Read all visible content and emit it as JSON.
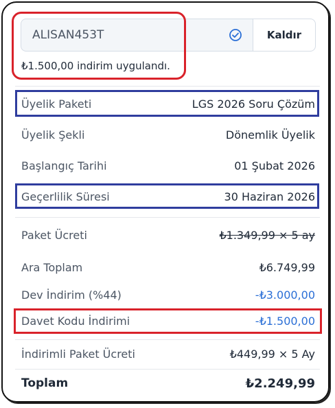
{
  "coupon": {
    "code": "ALISAN453T",
    "remove_label": "Kaldır",
    "applied_message": "₺1.500,00 indirim uygulandı."
  },
  "details": [
    {
      "label": "Üyelik Paketi",
      "value": "LGS 2026 Soru Çözüm"
    },
    {
      "label": "Üyelik Şekli",
      "value": "Dönemlik Üyelik"
    },
    {
      "label": "Başlangıç Tarihi",
      "value": "01 Şubat 2026"
    },
    {
      "label": "Geçerlilik Süresi",
      "value": "30 Haziran 2026"
    }
  ],
  "pricing": [
    {
      "label": "Paket Ücreti",
      "value": "₺1.349,99 × 5 ay"
    },
    {
      "label": "Ara Toplam",
      "value": "₺6.749,99"
    },
    {
      "label": "Dev İndirim (%44)",
      "value": "-₺3.000,00"
    },
    {
      "label": "Davet Kodu İndirimi",
      "value": "-₺1.500,00"
    }
  ],
  "discounted": {
    "label": "İndirimli Paket Ücreti",
    "value": "₺449,99 × 5 Ay"
  },
  "total": {
    "label": "Toplam",
    "value": "₺2.249,99"
  },
  "colors": {
    "highlight_red": "#d9222a",
    "highlight_blue": "#2f3d9e",
    "discount_blue": "#2b6fd6"
  }
}
